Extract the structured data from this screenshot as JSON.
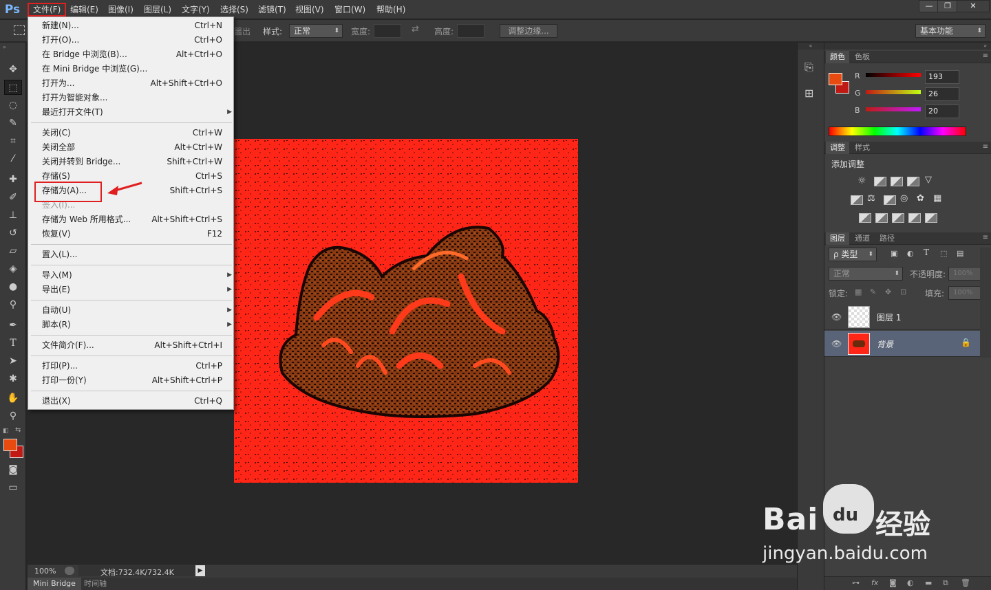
{
  "menubar": {
    "logo": "Ps",
    "items": [
      "文件(F)",
      "编辑(E)",
      "图像(I)",
      "图层(L)",
      "文字(Y)",
      "选择(S)",
      "滤镜(T)",
      "视图(V)",
      "窗口(W)",
      "帮助(H)"
    ],
    "window_controls": [
      "—",
      "❐",
      "✕"
    ]
  },
  "options": {
    "partial_label": "噐出",
    "style_label": "样式:",
    "style_value": "正常",
    "width_label": "宽度:",
    "height_label": "高度:",
    "refine_button": "调整边缘...",
    "workspace": "基本功能"
  },
  "file_menu": {
    "groups": [
      [
        {
          "label": "新建(N)...",
          "shortcut": "Ctrl+N"
        },
        {
          "label": "打开(O)...",
          "shortcut": "Ctrl+O"
        },
        {
          "label": "在 Bridge 中浏览(B)...",
          "shortcut": "Alt+Ctrl+O"
        },
        {
          "label": "在 Mini Bridge 中浏览(G)...",
          "shortcut": ""
        },
        {
          "label": "打开为...",
          "shortcut": "Alt+Shift+Ctrl+O"
        },
        {
          "label": "打开为智能对象...",
          "shortcut": ""
        },
        {
          "label": "最近打开文件(T)",
          "shortcut": "",
          "submenu": true
        }
      ],
      [
        {
          "label": "关闭(C)",
          "shortcut": "Ctrl+W"
        },
        {
          "label": "关闭全部",
          "shortcut": "Alt+Ctrl+W"
        },
        {
          "label": "关闭并转到 Bridge...",
          "shortcut": "Shift+Ctrl+W"
        },
        {
          "label": "存储(S)",
          "shortcut": "Ctrl+S"
        },
        {
          "label": "存储为(A)...",
          "shortcut": "Shift+Ctrl+S",
          "highlighted": true
        },
        {
          "label": "签入(I)...",
          "shortcut": "",
          "disabled": true
        },
        {
          "label": "存储为 Web 所用格式...",
          "shortcut": "Alt+Shift+Ctrl+S"
        },
        {
          "label": "恢复(V)",
          "shortcut": "F12"
        }
      ],
      [
        {
          "label": "置入(L)...",
          "shortcut": ""
        }
      ],
      [
        {
          "label": "导入(M)",
          "shortcut": "",
          "submenu": true
        },
        {
          "label": "导出(E)",
          "shortcut": "",
          "submenu": true
        }
      ],
      [
        {
          "label": "自动(U)",
          "shortcut": "",
          "submenu": true
        },
        {
          "label": "脚本(R)",
          "shortcut": "",
          "submenu": true
        }
      ],
      [
        {
          "label": "文件简介(F)...",
          "shortcut": "Alt+Shift+Ctrl+I"
        }
      ],
      [
        {
          "label": "打印(P)...",
          "shortcut": "Ctrl+P"
        },
        {
          "label": "打印一份(Y)",
          "shortcut": "Alt+Shift+Ctrl+P"
        }
      ],
      [
        {
          "label": "退出(X)",
          "shortcut": "Ctrl+Q"
        }
      ]
    ]
  },
  "status": {
    "zoom": "100%",
    "doc": "文档:732.4K/732.4K",
    "tabs": [
      "Mini Bridge",
      "时间轴"
    ]
  },
  "color_panel": {
    "tabs": [
      "颜色",
      "色板"
    ],
    "channels": [
      {
        "name": "R",
        "value": "193"
      },
      {
        "name": "G",
        "value": "26"
      },
      {
        "name": "B",
        "value": "20"
      }
    ],
    "fg_color": "#c11a14",
    "bg_color": "#c11a14"
  },
  "adjust_panel": {
    "tabs": [
      "调整",
      "样式"
    ],
    "title": "添加调整"
  },
  "layers_panel": {
    "tabs": [
      "图层",
      "通道",
      "路径"
    ],
    "filter": "ρ 类型",
    "blend": "正常",
    "opacity_label": "不透明度:",
    "opacity": "100%",
    "lock_label": "锁定:",
    "fill_label": "填充:",
    "fill": "100%",
    "layers": [
      {
        "name": "图层 1",
        "selected": false
      },
      {
        "name": "背景",
        "selected": true
      }
    ]
  },
  "watermark": {
    "brand": "Bai",
    "brand2": "经验",
    "url": "jingyan.baidu.com"
  }
}
